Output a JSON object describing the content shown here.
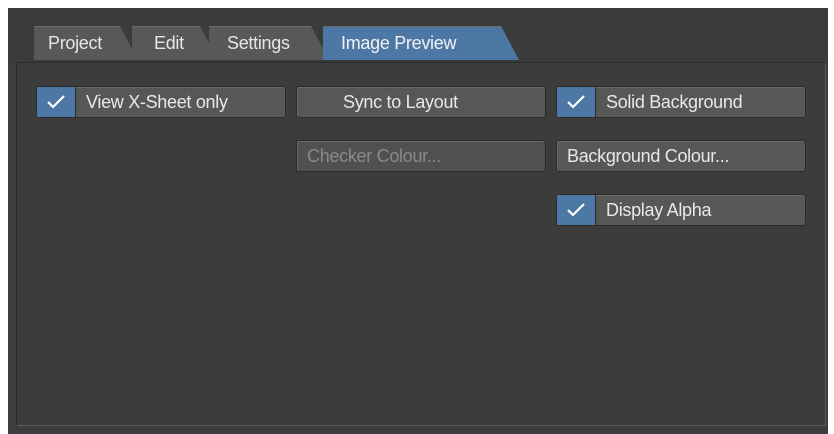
{
  "tabs": [
    {
      "label": "Project",
      "active": false
    },
    {
      "label": "Edit",
      "active": false
    },
    {
      "label": "Settings",
      "active": false
    },
    {
      "label": "Image Preview",
      "active": true
    }
  ],
  "controls": {
    "view_xsheet_only": {
      "label": "View X-Sheet only",
      "checked": true,
      "icon": "check-icon"
    },
    "sync_to_layout": {
      "label": "Sync to Layout",
      "checked": false
    },
    "solid_background": {
      "label": "Solid Background",
      "checked": true,
      "icon": "check-icon"
    },
    "checker_colour": {
      "label": "Checker Colour...",
      "enabled": false
    },
    "background_colour": {
      "label": "Background Colour...",
      "enabled": true
    },
    "display_alpha": {
      "label": "Display Alpha",
      "checked": true,
      "icon": "check-icon"
    }
  },
  "colors": {
    "accent": "#4d78a6",
    "panel_bg": "#3c3c3c",
    "button_bg": "#575757",
    "text": "#e8e8e8",
    "disabled_text": "#8a8a8a"
  }
}
